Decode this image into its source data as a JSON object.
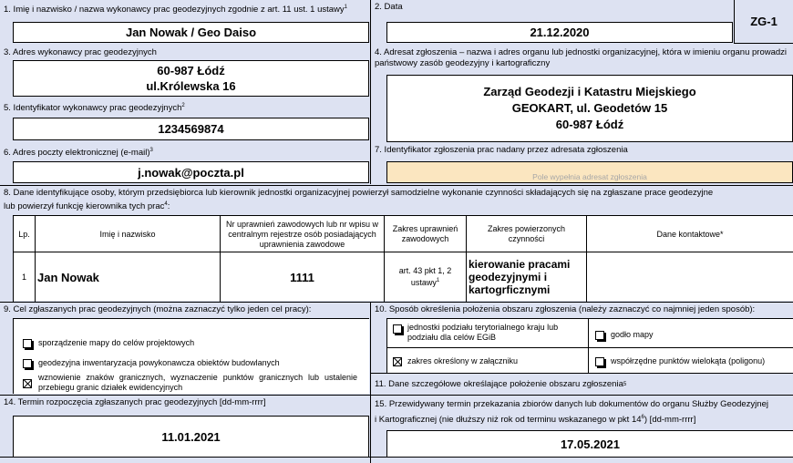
{
  "f1": {
    "label": "1. Imię i nazwisko / nazwa wykonawcy prac geodezyjnych zgodnie z art. 11 ust. 1 ustawy",
    "sup": "1",
    "value": "Jan Nowak / Geo Daiso"
  },
  "f2": {
    "label": "2. Data",
    "value": "21.12.2020"
  },
  "form_code": "ZG-1",
  "f3": {
    "label": "3. Adres wykonawcy prac geodezyjnych",
    "line1": "60-987 Łódź",
    "line2": "ul.Królewska 16"
  },
  "f4": {
    "label": "4. Adresat zgłoszenia – nazwa i adres organu lub jednostki organizacyjnej, która  w imieniu organu prowadzi państwowy zasób geodezyjny i kartograficzny",
    "line1": "Zarząd Geodezji i Katastru Miejskiego",
    "line2": "GEOKART, ul. Geodetów 15",
    "line3": "60-987 Łódź"
  },
  "f5": {
    "label": "5. Identyfikator wykonawcy prac geodezyjnych",
    "sup": "2",
    "value": "1234569874"
  },
  "f6": {
    "label": "6. Adres poczty elektronicznej (e-mail)",
    "sup": "3",
    "value": "j.nowak@poczta.pl"
  },
  "f7": {
    "label": "7. Identyfikator zgłoszenia prac nadany przez adresata zgłoszenia",
    "placeholder": "Pole wypełnia adresat zgłoszenia"
  },
  "f8": {
    "label_line1": "8. Dane identyfikujące osoby, którym przedsiębiorca lub kierownik jednostki organizacyjnej powierzył samodzielne wykonanie czynności składających się na zgłaszane prace geodezyjne",
    "label_line2": "lub powierzył funkcję kierownika tych prac",
    "sup": "4",
    "columns": {
      "lp": "Lp.",
      "name": "Imię i nazwisko",
      "license": "Nr uprawnień zawodowych lub nr wpisu w centralnym rejestrze osób posiadających uprawnienia zawodowe",
      "scope": "Zakres uprawnień zawodowych",
      "duties": "Zakres powierzonych czynności",
      "contact": "Dane kontaktowe*"
    },
    "rows": [
      {
        "lp": "1",
        "name": "Jan Nowak",
        "license": "1111",
        "scope": "art. 43 pkt 1, 2 ustawy",
        "scope_sup": "1",
        "duties": "kierowanie pracami geodezyjnymi i kartogrficznymi",
        "contact": ""
      }
    ]
  },
  "f9": {
    "label": "9. Cel zgłaszanych prac geodezyjnych (można zaznaczyć tylko jeden cel pracy):",
    "options": [
      {
        "text": "sporządzenie mapy do celów projektowych",
        "checked": false
      },
      {
        "text": "geodezyjna inwentaryzacja powykonawcza obiektów budowlanych",
        "checked": false
      },
      {
        "text": "wznowienie znaków granicznych, wyznaczenie punktów granicznych lub ustalenie przebiegu granic działek ewidencyjnych",
        "checked": true
      }
    ]
  },
  "f10": {
    "label": "10. Sposób określenia położenia obszaru zgłoszenia (należy zaznaczyć co najmniej jeden sposób):",
    "opt_units": "jednostki podziału terytorialnego kraju lub podziału dla celów EGiB",
    "opt_godlo": "godło mapy",
    "opt_attachment": "zakres określony w załączniku",
    "opt_polygon": "współrzędne punktów wielokąta (poligonu)"
  },
  "f11": {
    "label": "11. Dane szczegółowe określające położenie obszaru zgłoszenia",
    "sup": "5"
  },
  "f14": {
    "label": "14. Termin rozpoczęcia zgłaszanych prac geodezyjnych [dd-mm-rrrr]",
    "value": "11.01.2021"
  },
  "f15": {
    "label_line1": "15. Przewidywany termin przekazania zbiorów danych lub dokumentów do organu Służby Geodezyjnej",
    "label_line2a": "i Kartograficznej (nie dłuższy niż rok od terminu wskazanego w pkt 14",
    "sup": "6",
    "label_line2b": ")  [dd-mm-rrrr]",
    "value": "17.05.2021"
  }
}
